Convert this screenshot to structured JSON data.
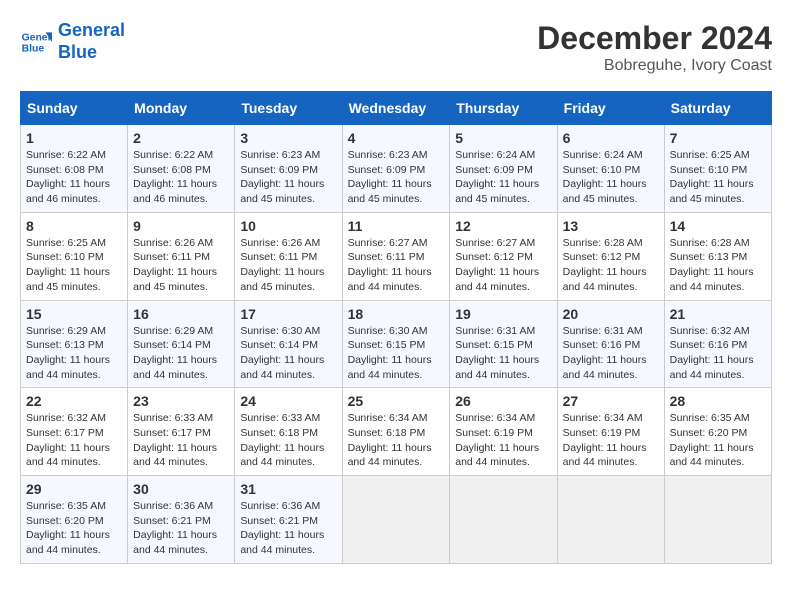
{
  "header": {
    "logo_line1": "General",
    "logo_line2": "Blue",
    "month_year": "December 2024",
    "location": "Bobreguhe, Ivory Coast"
  },
  "columns": [
    "Sunday",
    "Monday",
    "Tuesday",
    "Wednesday",
    "Thursday",
    "Friday",
    "Saturday"
  ],
  "weeks": [
    [
      {
        "day": "1",
        "info": "Sunrise: 6:22 AM\nSunset: 6:08 PM\nDaylight: 11 hours\nand 46 minutes."
      },
      {
        "day": "2",
        "info": "Sunrise: 6:22 AM\nSunset: 6:08 PM\nDaylight: 11 hours\nand 46 minutes."
      },
      {
        "day": "3",
        "info": "Sunrise: 6:23 AM\nSunset: 6:09 PM\nDaylight: 11 hours\nand 45 minutes."
      },
      {
        "day": "4",
        "info": "Sunrise: 6:23 AM\nSunset: 6:09 PM\nDaylight: 11 hours\nand 45 minutes."
      },
      {
        "day": "5",
        "info": "Sunrise: 6:24 AM\nSunset: 6:09 PM\nDaylight: 11 hours\nand 45 minutes."
      },
      {
        "day": "6",
        "info": "Sunrise: 6:24 AM\nSunset: 6:10 PM\nDaylight: 11 hours\nand 45 minutes."
      },
      {
        "day": "7",
        "info": "Sunrise: 6:25 AM\nSunset: 6:10 PM\nDaylight: 11 hours\nand 45 minutes."
      }
    ],
    [
      {
        "day": "8",
        "info": "Sunrise: 6:25 AM\nSunset: 6:10 PM\nDaylight: 11 hours\nand 45 minutes."
      },
      {
        "day": "9",
        "info": "Sunrise: 6:26 AM\nSunset: 6:11 PM\nDaylight: 11 hours\nand 45 minutes."
      },
      {
        "day": "10",
        "info": "Sunrise: 6:26 AM\nSunset: 6:11 PM\nDaylight: 11 hours\nand 45 minutes."
      },
      {
        "day": "11",
        "info": "Sunrise: 6:27 AM\nSunset: 6:11 PM\nDaylight: 11 hours\nand 44 minutes."
      },
      {
        "day": "12",
        "info": "Sunrise: 6:27 AM\nSunset: 6:12 PM\nDaylight: 11 hours\nand 44 minutes."
      },
      {
        "day": "13",
        "info": "Sunrise: 6:28 AM\nSunset: 6:12 PM\nDaylight: 11 hours\nand 44 minutes."
      },
      {
        "day": "14",
        "info": "Sunrise: 6:28 AM\nSunset: 6:13 PM\nDaylight: 11 hours\nand 44 minutes."
      }
    ],
    [
      {
        "day": "15",
        "info": "Sunrise: 6:29 AM\nSunset: 6:13 PM\nDaylight: 11 hours\nand 44 minutes."
      },
      {
        "day": "16",
        "info": "Sunrise: 6:29 AM\nSunset: 6:14 PM\nDaylight: 11 hours\nand 44 minutes."
      },
      {
        "day": "17",
        "info": "Sunrise: 6:30 AM\nSunset: 6:14 PM\nDaylight: 11 hours\nand 44 minutes."
      },
      {
        "day": "18",
        "info": "Sunrise: 6:30 AM\nSunset: 6:15 PM\nDaylight: 11 hours\nand 44 minutes."
      },
      {
        "day": "19",
        "info": "Sunrise: 6:31 AM\nSunset: 6:15 PM\nDaylight: 11 hours\nand 44 minutes."
      },
      {
        "day": "20",
        "info": "Sunrise: 6:31 AM\nSunset: 6:16 PM\nDaylight: 11 hours\nand 44 minutes."
      },
      {
        "day": "21",
        "info": "Sunrise: 6:32 AM\nSunset: 6:16 PM\nDaylight: 11 hours\nand 44 minutes."
      }
    ],
    [
      {
        "day": "22",
        "info": "Sunrise: 6:32 AM\nSunset: 6:17 PM\nDaylight: 11 hours\nand 44 minutes."
      },
      {
        "day": "23",
        "info": "Sunrise: 6:33 AM\nSunset: 6:17 PM\nDaylight: 11 hours\nand 44 minutes."
      },
      {
        "day": "24",
        "info": "Sunrise: 6:33 AM\nSunset: 6:18 PM\nDaylight: 11 hours\nand 44 minutes."
      },
      {
        "day": "25",
        "info": "Sunrise: 6:34 AM\nSunset: 6:18 PM\nDaylight: 11 hours\nand 44 minutes."
      },
      {
        "day": "26",
        "info": "Sunrise: 6:34 AM\nSunset: 6:19 PM\nDaylight: 11 hours\nand 44 minutes."
      },
      {
        "day": "27",
        "info": "Sunrise: 6:34 AM\nSunset: 6:19 PM\nDaylight: 11 hours\nand 44 minutes."
      },
      {
        "day": "28",
        "info": "Sunrise: 6:35 AM\nSunset: 6:20 PM\nDaylight: 11 hours\nand 44 minutes."
      }
    ],
    [
      {
        "day": "29",
        "info": "Sunrise: 6:35 AM\nSunset: 6:20 PM\nDaylight: 11 hours\nand 44 minutes."
      },
      {
        "day": "30",
        "info": "Sunrise: 6:36 AM\nSunset: 6:21 PM\nDaylight: 11 hours\nand 44 minutes."
      },
      {
        "day": "31",
        "info": "Sunrise: 6:36 AM\nSunset: 6:21 PM\nDaylight: 11 hours\nand 44 minutes."
      },
      null,
      null,
      null,
      null
    ]
  ]
}
